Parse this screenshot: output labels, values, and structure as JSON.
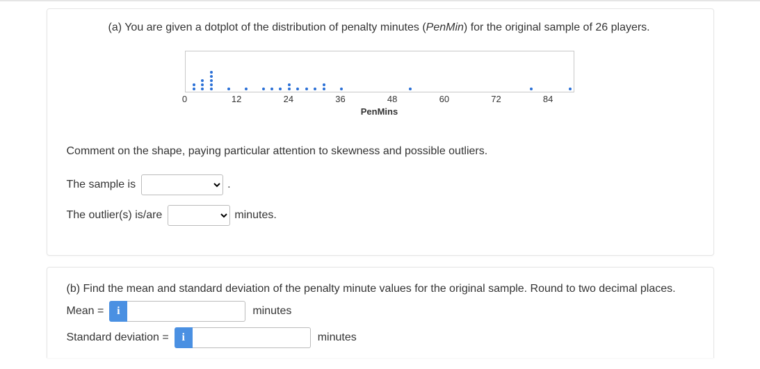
{
  "partA": {
    "prompt_pre": "(a) You are given a dotplot of the distribution of penalty minutes (",
    "prompt_em": "PenMin",
    "prompt_post": ") for the original sample of 26 players.",
    "comment": "Comment on the shape, paying particular attention to skewness and possible outliers.",
    "sample_pre": "The sample is",
    "sample_post": ".",
    "outlier_pre": "The outlier(s) is/are",
    "outlier_post": "minutes."
  },
  "partB": {
    "prompt": "(b) Find the mean and standard deviation of the penalty minute values for the original sample. Round to two decimal places.",
    "mean_label": "Mean =",
    "sd_label": "Standard deviation =",
    "unit": "minutes",
    "info_icon": "i"
  },
  "chart_data": {
    "type": "dotplot",
    "xlabel": "PenMins",
    "xlim": [
      0,
      90
    ],
    "ticks": [
      0,
      12,
      24,
      36,
      48,
      60,
      72,
      84
    ],
    "points": [
      {
        "x": 2,
        "count": 2
      },
      {
        "x": 4,
        "count": 3
      },
      {
        "x": 6,
        "count": 5
      },
      {
        "x": 10,
        "count": 1
      },
      {
        "x": 14,
        "count": 1
      },
      {
        "x": 18,
        "count": 1
      },
      {
        "x": 20,
        "count": 1
      },
      {
        "x": 22,
        "count": 1
      },
      {
        "x": 24,
        "count": 2
      },
      {
        "x": 26,
        "count": 1
      },
      {
        "x": 28,
        "count": 1
      },
      {
        "x": 30,
        "count": 1
      },
      {
        "x": 32,
        "count": 2
      },
      {
        "x": 36,
        "count": 1
      },
      {
        "x": 52,
        "count": 1
      },
      {
        "x": 80,
        "count": 1
      },
      {
        "x": 89,
        "count": 1
      }
    ]
  }
}
